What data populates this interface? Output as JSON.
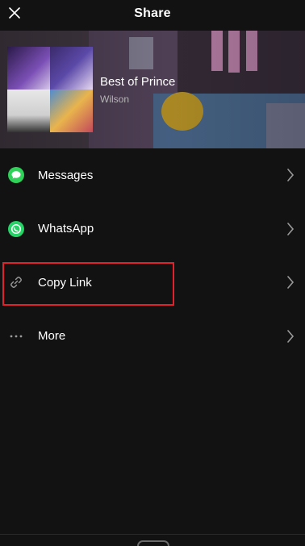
{
  "header": {
    "title": "Share"
  },
  "playlist": {
    "name": "Best of Prince",
    "owner": "Wilson"
  },
  "share_options": [
    {
      "label": "Messages",
      "icon": "messages-icon",
      "color": "#2fd158"
    },
    {
      "label": "WhatsApp",
      "icon": "whatsapp-icon",
      "color": "#25d366"
    },
    {
      "label": "Copy Link",
      "icon": "link-icon",
      "color": "#9a9a9a"
    },
    {
      "label": "More",
      "icon": "more-icon",
      "color": "#9a9a9a"
    }
  ],
  "colors": {
    "background": "#121212",
    "highlight": "#e0222c"
  }
}
